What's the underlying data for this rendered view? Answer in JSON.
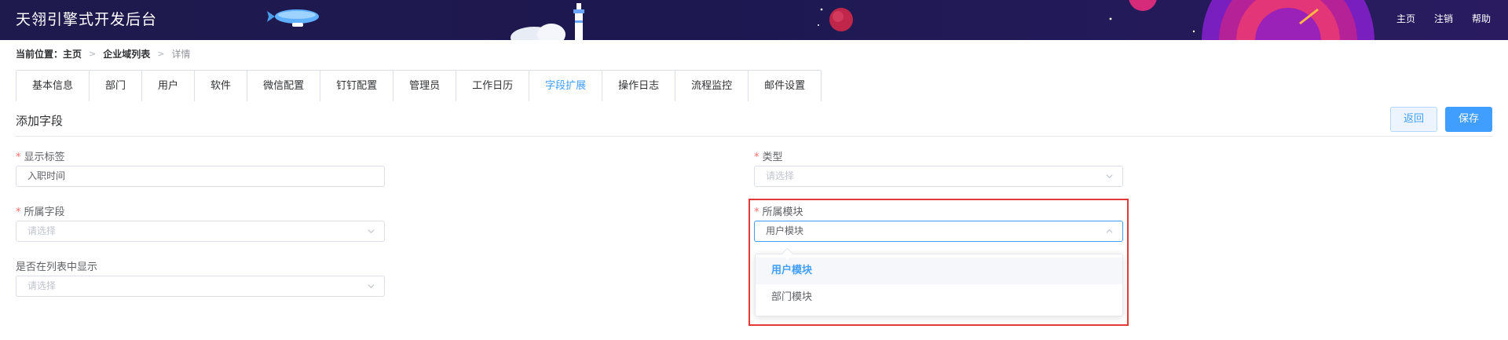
{
  "app": {
    "title": "天翎引擎式开发后台"
  },
  "header_nav": {
    "home": "主页",
    "logout": "注销",
    "help": "帮助"
  },
  "breadcrumb": {
    "prefix": "当前位置：",
    "home": "主页",
    "list": "企业域列表",
    "current": "详情"
  },
  "tabs": [
    {
      "label": "基本信息"
    },
    {
      "label": "部门"
    },
    {
      "label": "用户"
    },
    {
      "label": "软件"
    },
    {
      "label": "微信配置"
    },
    {
      "label": "钉钉配置"
    },
    {
      "label": "管理员"
    },
    {
      "label": "工作日历"
    },
    {
      "label": "字段扩展",
      "active": true
    },
    {
      "label": "操作日志"
    },
    {
      "label": "流程监控"
    },
    {
      "label": "邮件设置"
    }
  ],
  "section": {
    "title": "添加字段",
    "back_label": "返回",
    "save_label": "保存"
  },
  "form": {
    "required_mark": "*",
    "display_label": {
      "label": "显示标签",
      "value": "入职时间"
    },
    "type": {
      "label": "类型",
      "placeholder": "请选择"
    },
    "field": {
      "label": "所属字段",
      "placeholder": "请选择"
    },
    "module": {
      "label": "所属模块",
      "value": "用户模块"
    },
    "show_in_list": {
      "label": "是否在列表中显示",
      "placeholder": "请选择"
    }
  },
  "module_options": [
    {
      "label": "用户模块",
      "selected": true
    },
    {
      "label": "部门模块",
      "selected": false
    }
  ],
  "colors": {
    "accent": "#409eff",
    "required": "#f56c6c",
    "highlight": "#e53935",
    "header_bg": "#1f1a4d"
  }
}
